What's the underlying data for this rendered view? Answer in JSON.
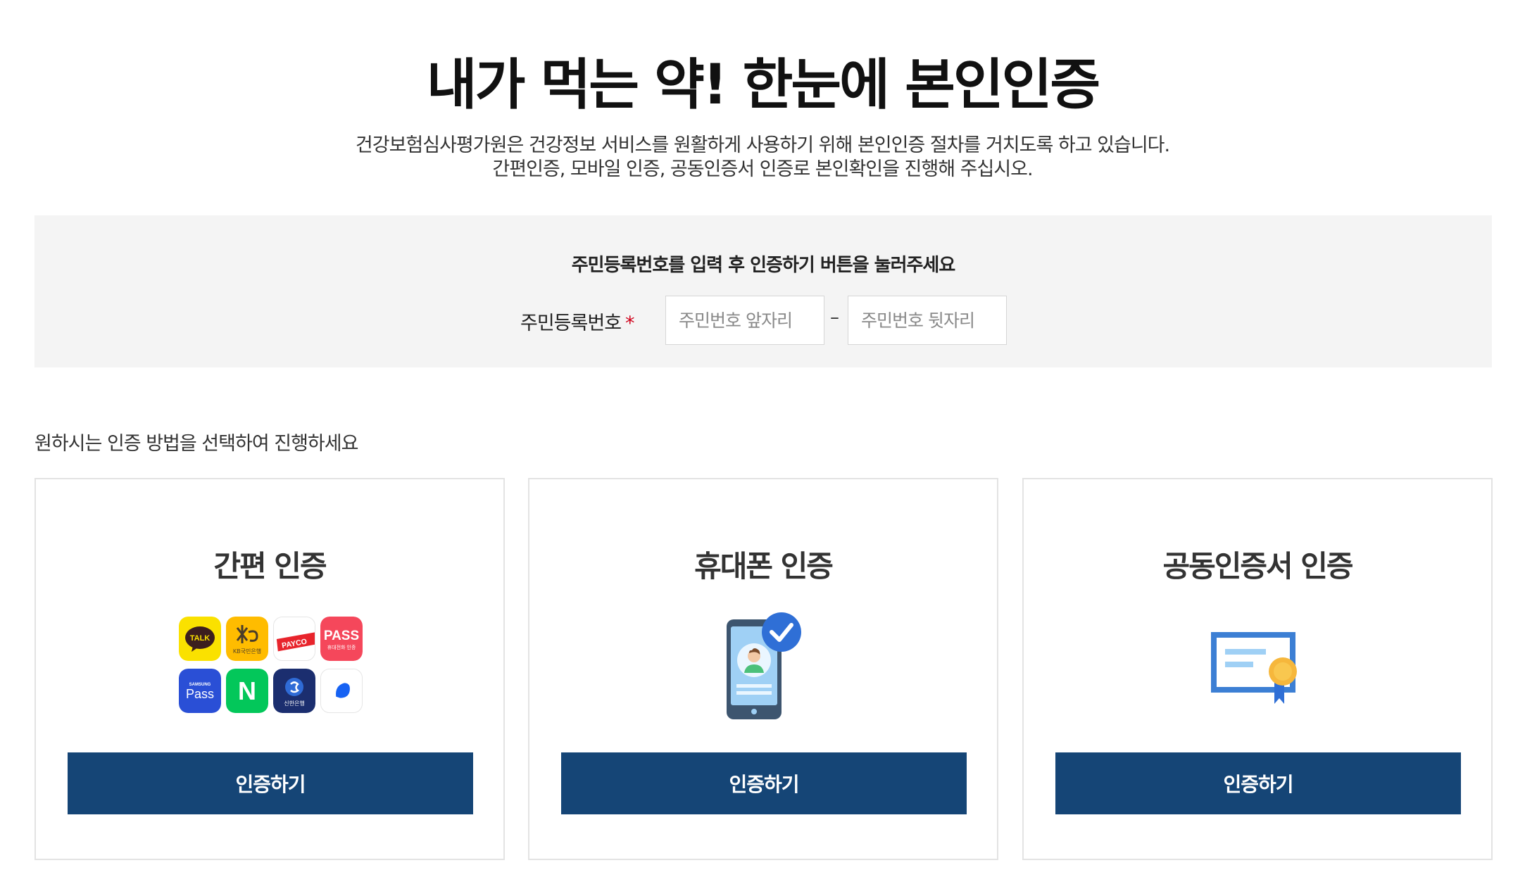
{
  "page": {
    "title": "내가 먹는 약! 한눈에 본인인증",
    "description_line1": "건강보험심사평가원은 건강정보 서비스를 원활하게 사용하기 위해 본인인증 절차를 거치도록 하고 있습니다.",
    "description_line2": "간편인증, 모바일 인증, 공동인증서 인증로 본인확인을 진행해 주십시오."
  },
  "id_form": {
    "instruction": "주민등록번호를 입력 후 인증하기 버튼을 눌러주세요",
    "label": "주민등록번호",
    "required_mark": "*",
    "front_placeholder": "주민번호 앞자리",
    "front_value": "",
    "separator": "–",
    "back_placeholder": "주민번호 뒷자리",
    "back_value": ""
  },
  "methods": {
    "prompt": "원하시는 인증 방법을 선택하여 진행하세요",
    "cards": [
      {
        "title": "간편 인증",
        "button_label": "인증하기",
        "apps": [
          {
            "icon": "kakaotalk-icon",
            "text": "TALK",
            "color": "#fae100"
          },
          {
            "icon": "kb-bank-icon",
            "text": "KB국민은행",
            "color": "#ffbc00"
          },
          {
            "icon": "payco-icon",
            "text": "PAYCO",
            "color": "#ffffff"
          },
          {
            "icon": "pass-icon",
            "text": "PASS",
            "subtext": "휴대전화 인증",
            "color": "#f5475b"
          },
          {
            "icon": "samsung-pass-icon",
            "text": "Pass",
            "subtext": "SAMSUNG",
            "color": "#2a4fd6"
          },
          {
            "icon": "naver-icon",
            "text": "N",
            "color": "#03c75a"
          },
          {
            "icon": "shinhan-bank-icon",
            "text": "신한은행",
            "color": "#1b2e6f"
          },
          {
            "icon": "toss-icon",
            "text": "",
            "color": "#ffffff"
          }
        ]
      },
      {
        "title": "휴대폰 인증",
        "button_label": "인증하기",
        "illustration": "smartphone-check-icon"
      },
      {
        "title": "공동인증서 인증",
        "button_label": "인증하기",
        "illustration": "certificate-icon"
      }
    ]
  },
  "colors": {
    "primary_button": "#154576",
    "panel_background": "#f4f4f4",
    "required": "#d0021b"
  }
}
